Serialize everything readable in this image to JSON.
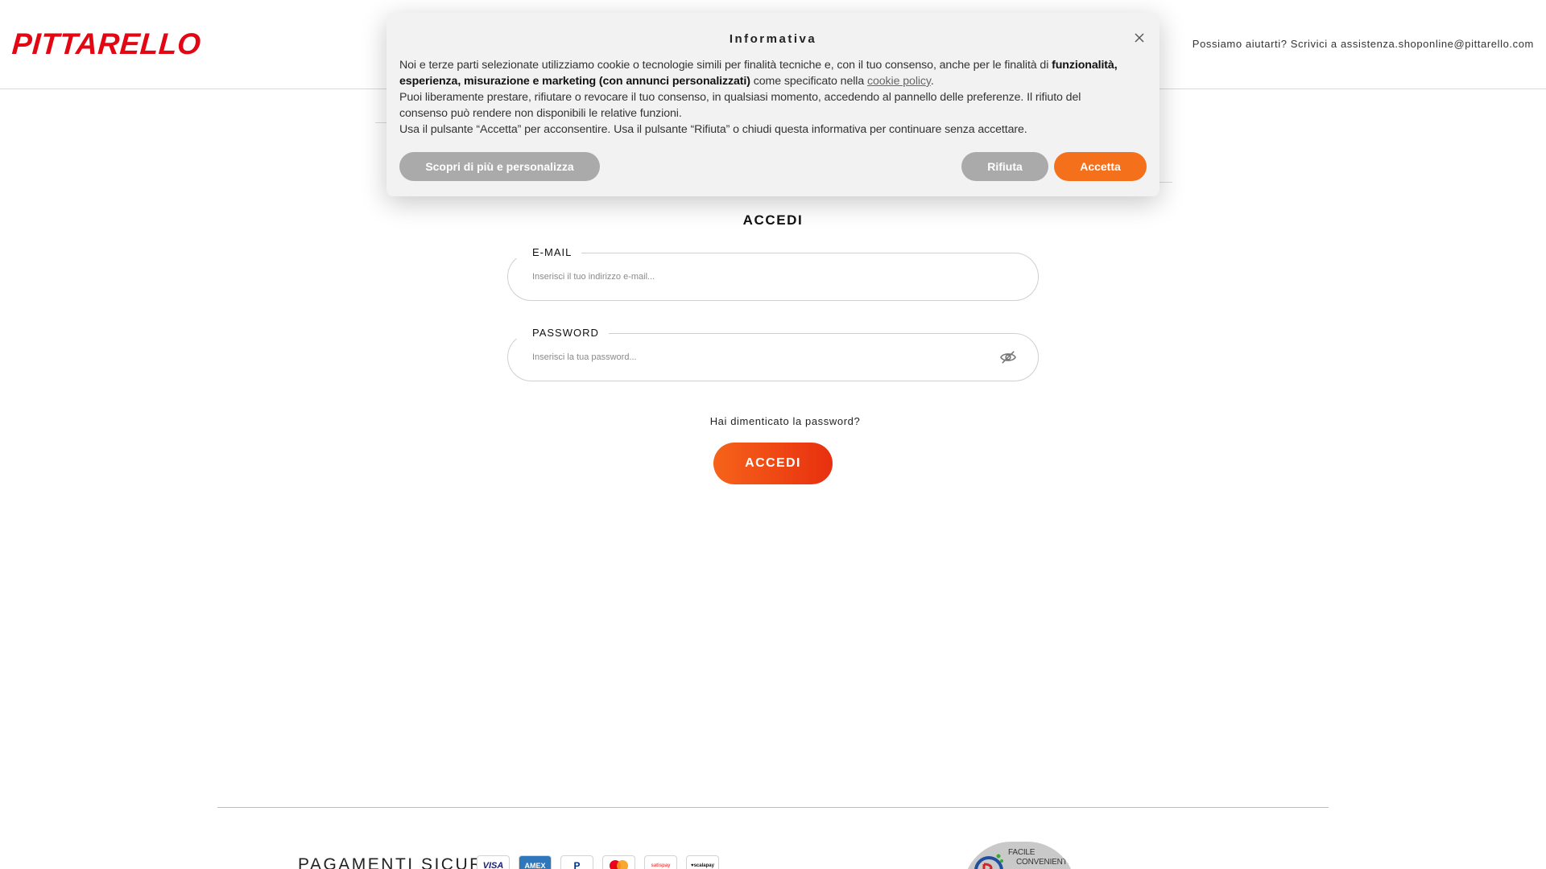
{
  "header": {
    "logo_text": "PITTARELLO",
    "help_text": "Possiamo aiutarti? Scrivici a assistenza.shoponline@pittarello.com"
  },
  "login": {
    "title": "ACCEDI",
    "email_label": "E-MAIL",
    "email_placeholder": "Inserisci il tuo indirizzo e-mail...",
    "password_label": "PASSWORD",
    "password_placeholder": "Inserisci la tua password...",
    "forgot_link": "Hai dimenticato la password?",
    "submit_label": "ACCEDI"
  },
  "footer": {
    "secure_payments_label": "PAGAMENTI SICURI",
    "payment_methods": [
      "VISA",
      "AMEX",
      "P",
      "",
      "satispay",
      "♥scalapay"
    ],
    "badge_text_1": "FACILE",
    "badge_text_2": "CONVENIENTE"
  },
  "cookie_modal": {
    "title": "Informativa",
    "text_1": "Noi e terze parti selezionate utilizziamo cookie o tecnologie simili per finalità tecniche e, con il tuo consenso, anche per le finalità di ",
    "text_bold": "funzionalità, esperienza, misurazione e marketing (con annunci personalizzati)",
    "text_2": " come specificato nella ",
    "cookie_policy_link": "cookie policy",
    "text_3": ".",
    "paragraph_2": "Puoi liberamente prestare, rifiutare o revocare il tuo consenso, in qualsiasi momento, accedendo al pannello delle preferenze. Il rifiuto del consenso può rendere non disponibili le relative funzioni.",
    "paragraph_3": "Usa il pulsante “Accetta” per acconsentire. Usa il pulsante “Rifiuta” o chiudi questa informativa per continuare senza accettare.",
    "more_button": "Scopri di più e personalizza",
    "reject_button": "Rifiuta",
    "accept_button": "Accetta"
  },
  "colors": {
    "brand_red": "#e30613",
    "accent_orange": "#f4701b",
    "grey_button": "#aaaaaa"
  }
}
